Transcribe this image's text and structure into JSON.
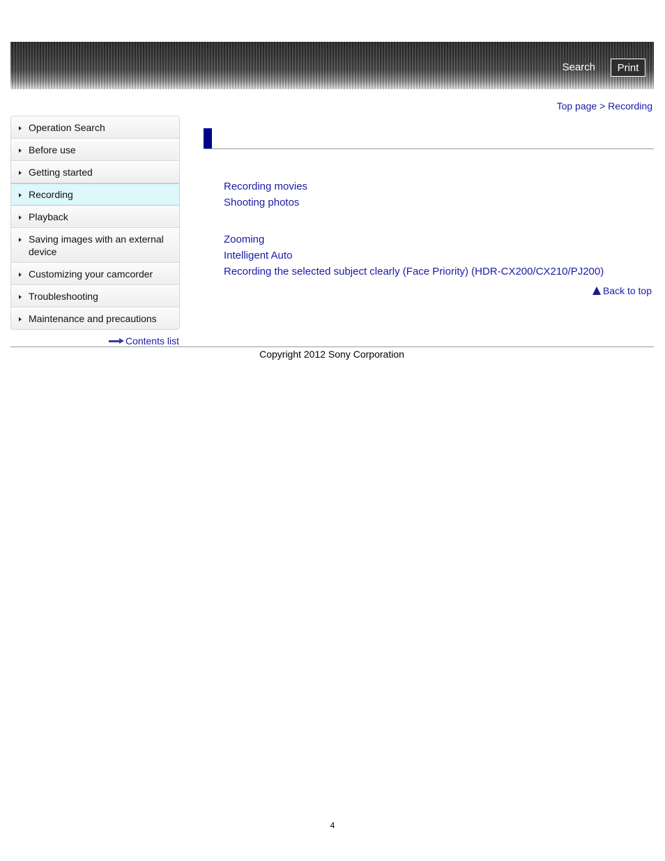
{
  "header": {
    "search_label": "Search",
    "print_label": "Print"
  },
  "breadcrumb": {
    "items": [
      "Top page",
      "Recording"
    ],
    "separator": " > "
  },
  "sidebar": {
    "items": [
      {
        "label": "Operation Search",
        "active": false
      },
      {
        "label": "Before use",
        "active": false
      },
      {
        "label": "Getting started",
        "active": false
      },
      {
        "label": "Recording",
        "active": true
      },
      {
        "label": "Playback",
        "active": false
      },
      {
        "label": "Saving images with an external device",
        "active": false
      },
      {
        "label": "Customizing your camcorder",
        "active": false
      },
      {
        "label": "Troubleshooting",
        "active": false
      },
      {
        "label": "Maintenance and precautions",
        "active": false
      }
    ],
    "contents_link": "Contents list"
  },
  "main": {
    "title": "",
    "groups": [
      {
        "links": [
          "Recording movies",
          "Shooting photos"
        ]
      },
      {
        "links": [
          "Zooming",
          "Intelligent Auto",
          "Recording the selected subject clearly (Face Priority) (HDR-CX200/CX210/PJ200)"
        ]
      }
    ],
    "back_to_top": "Back to top"
  },
  "footer": {
    "copyright": "Copyright 2012 Sony Corporation",
    "page_number": "4"
  },
  "colors": {
    "link": "#1a1aa6",
    "title_marker": "#00008b",
    "active_item_bg": "#ddf7fb",
    "active_item_border": "#7fdcea"
  }
}
